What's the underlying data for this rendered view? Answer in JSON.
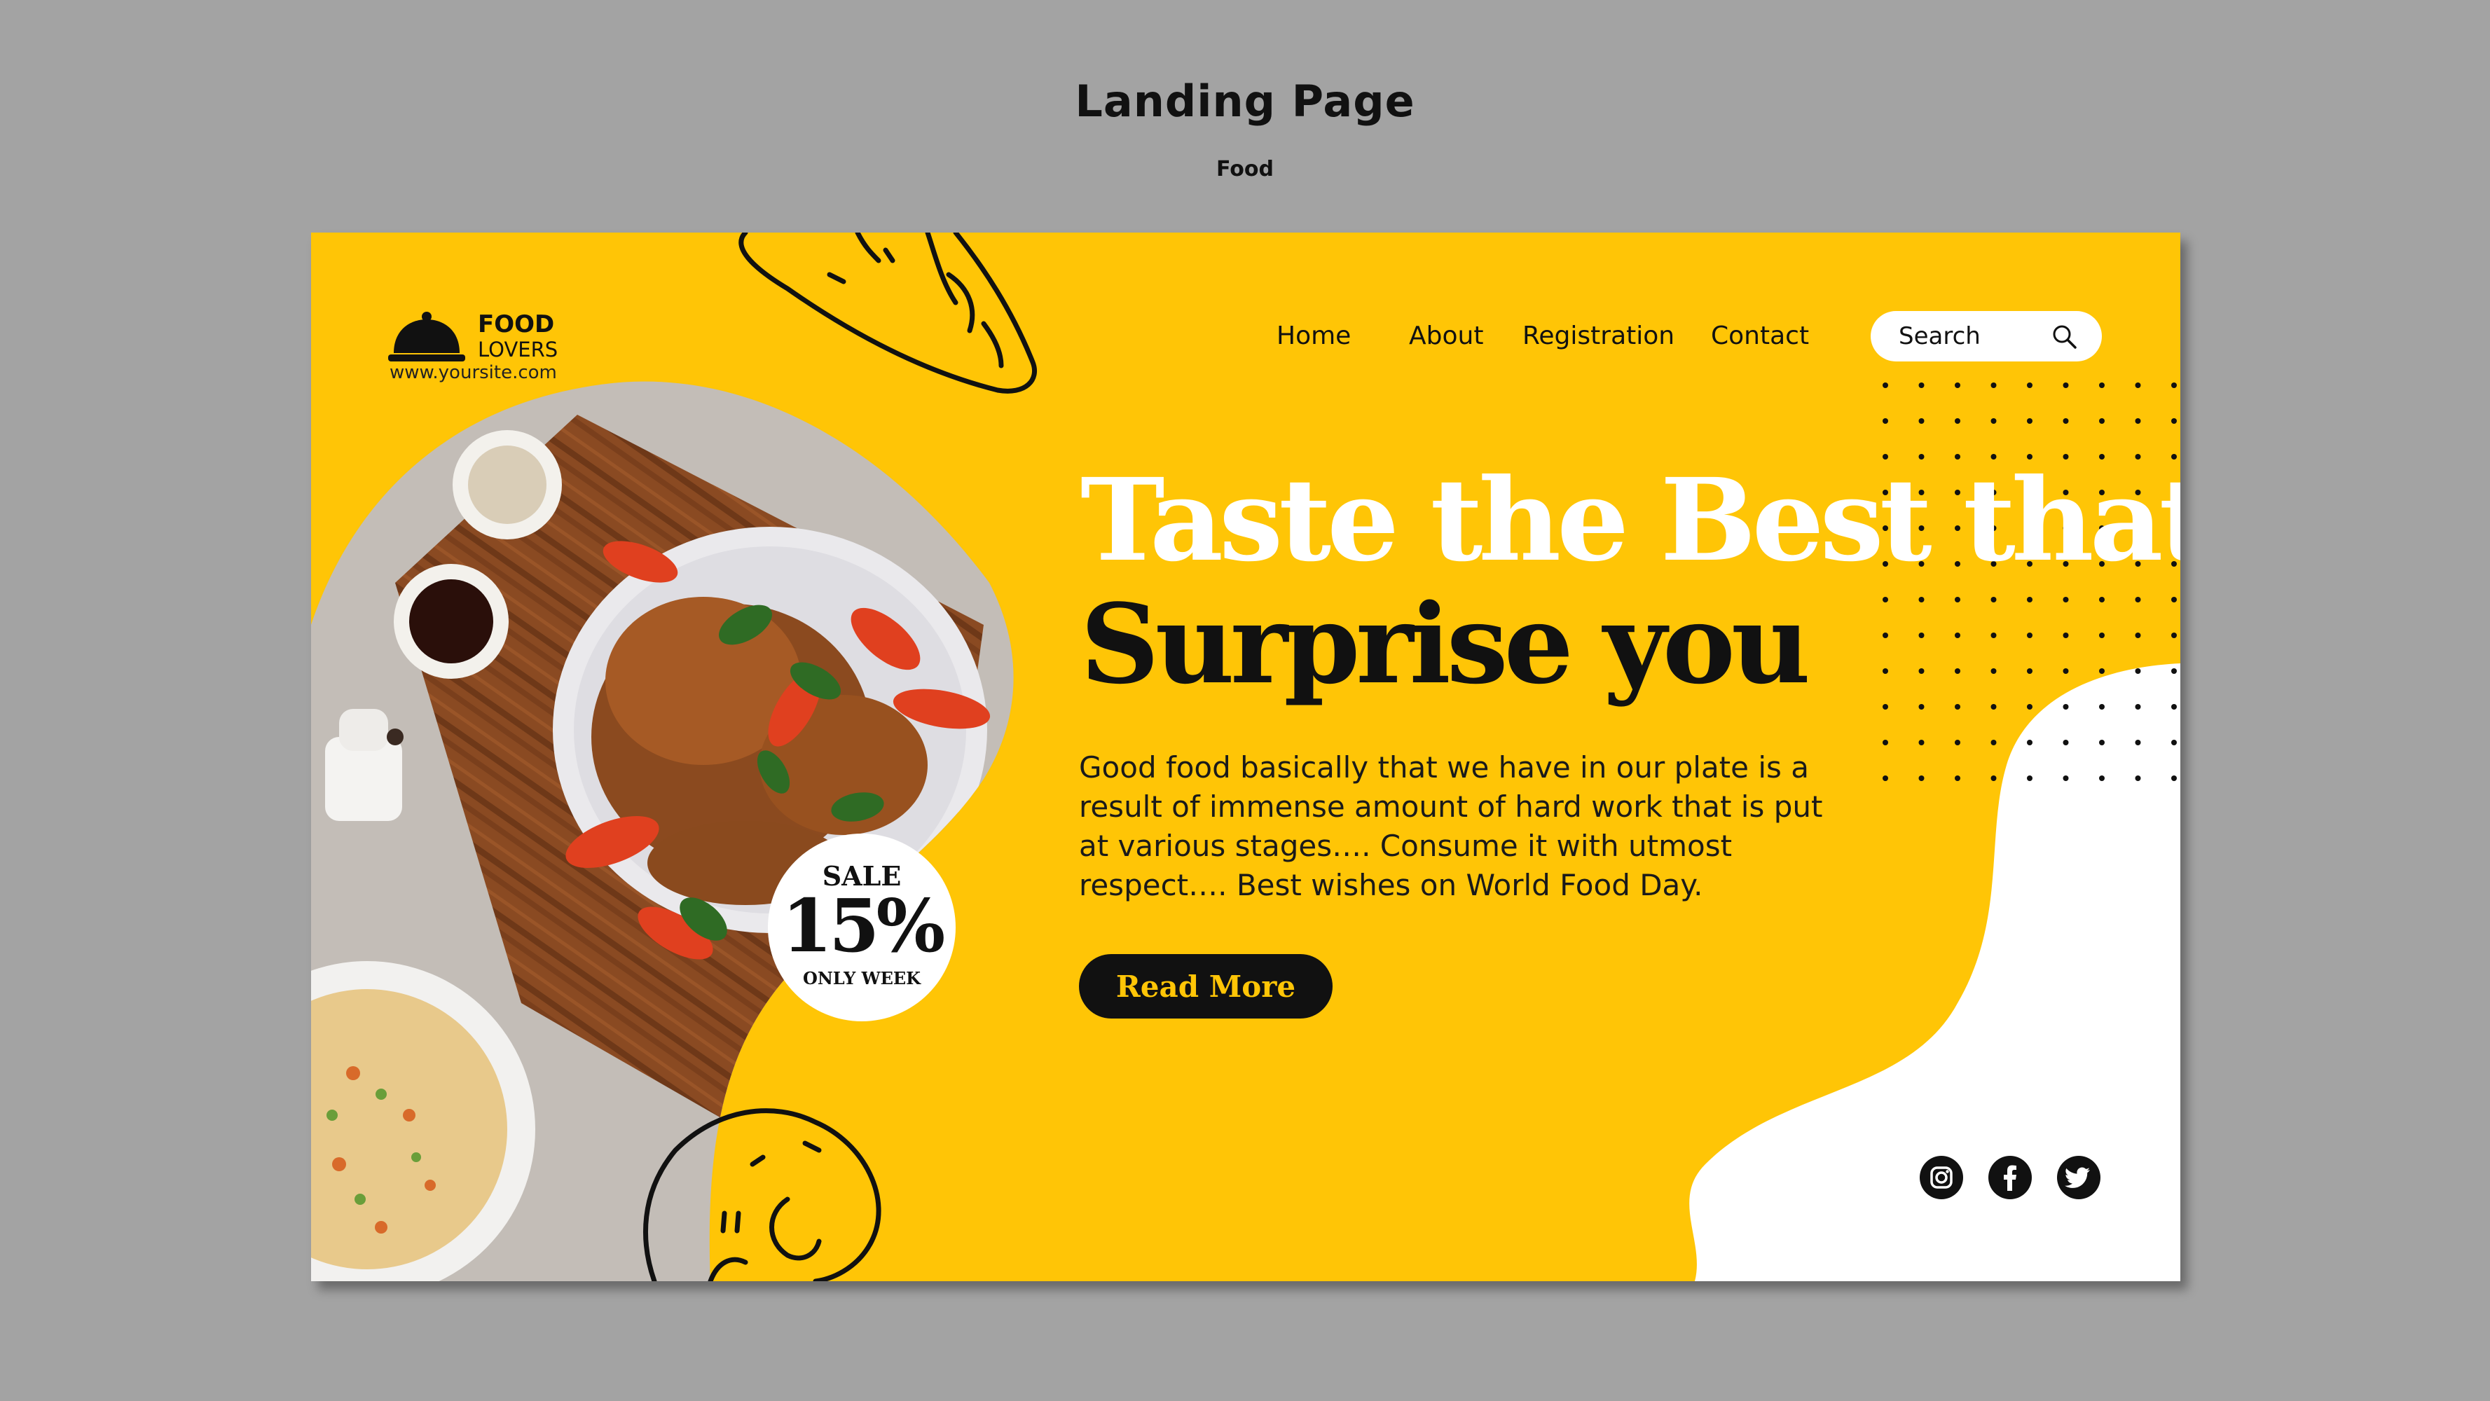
{
  "frame": {
    "title": "Landing Page",
    "subtitle": "Food"
  },
  "brand": {
    "line1": "FOOD",
    "line2": "LOVERS",
    "url": "www.yoursite.com"
  },
  "nav": {
    "items": [
      {
        "label": "Home"
      },
      {
        "label": "About"
      },
      {
        "label": "Registration"
      },
      {
        "label": "Contact"
      }
    ]
  },
  "search": {
    "placeholder": "Search"
  },
  "hero": {
    "headline_line1": "Taste the Best that",
    "headline_line2": "Surprise you",
    "body": "Good food basically that we have in our plate is a result of immense amount of hard work that is put at various stages…. Consume it with utmost respect…. Best wishes on World Food Day.",
    "cta_label": "Read More"
  },
  "sale": {
    "word": "SALE",
    "percent": "15%",
    "note": "ONLY WEEK"
  },
  "social": {
    "icons": [
      "instagram-icon",
      "facebook-icon",
      "twitter-icon"
    ]
  },
  "colors": {
    "background": "#a3a3a3",
    "accent_yellow": "#ffc506",
    "dark": "#111111",
    "white": "#ffffff"
  }
}
